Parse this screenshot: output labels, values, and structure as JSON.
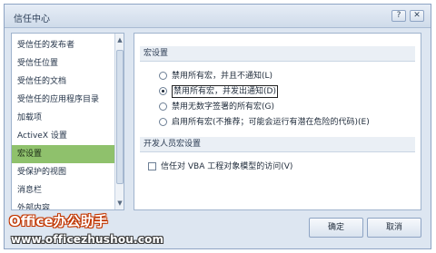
{
  "window": {
    "title": "信任中心",
    "help_glyph": "?",
    "close_glyph": "✕"
  },
  "nav": {
    "items": [
      {
        "label": "受信任的发布者",
        "selected": false
      },
      {
        "label": "受信任位置",
        "selected": false
      },
      {
        "label": "受信任的文档",
        "selected": false
      },
      {
        "label": "受信任的应用程序目录",
        "selected": false
      },
      {
        "label": "加载项",
        "selected": false
      },
      {
        "label": "ActiveX 设置",
        "selected": false
      },
      {
        "label": "宏设置",
        "selected": true
      },
      {
        "label": "受保护的视图",
        "selected": false
      },
      {
        "label": "消息栏",
        "selected": false
      },
      {
        "label": "外部内容",
        "selected": false
      }
    ],
    "scroll_up_glyph": "▲",
    "scroll_down_glyph": "▼"
  },
  "macro_settings": {
    "heading": "宏设置",
    "options": [
      {
        "label": "禁用所有宏，并且不通知(L)",
        "selected": false
      },
      {
        "label": "禁用所有宏，并发出通知(D)",
        "selected": true
      },
      {
        "label": "禁用无数字签署的所有宏(G)",
        "selected": false
      },
      {
        "label": "启用所有宏(不推荐；可能会运行有潜在危险的代码)(E)",
        "selected": false
      }
    ]
  },
  "developer_settings": {
    "heading": "开发人员宏设置",
    "vba_access": {
      "label": "信任对 VBA 工程对象模型的访问(V)",
      "checked": false
    }
  },
  "buttons": {
    "ok": "确定",
    "cancel": "取消"
  },
  "branding": {
    "logo_text": "Office办公助手",
    "watermark_url": "www.officezhushou.com"
  },
  "colors": {
    "selected_nav": "#8fc16c",
    "logo": "#c93b00",
    "dialog_bg": "#dde6f1"
  }
}
